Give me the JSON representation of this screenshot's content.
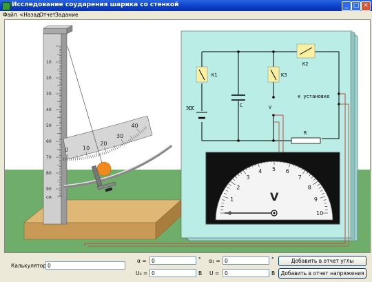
{
  "window": {
    "title": "Исследование соударения шарика со стенкой",
    "min": "_",
    "max": "□",
    "close": "×"
  },
  "menu": [
    {
      "label": "Файл"
    },
    {
      "label": "<Назад"
    },
    {
      "label": "Отчет"
    },
    {
      "label": "Задание"
    }
  ],
  "ruler": {
    "ticks": [
      "10",
      "20",
      "30",
      "40",
      "50",
      "60",
      "70",
      "80",
      "90"
    ],
    "unit": "см"
  },
  "protractor": {
    "ticks": [
      "0",
      "10",
      "20",
      "30",
      "40"
    ]
  },
  "circuit": {
    "k1": "K1",
    "k2": "K2",
    "k3": "K3",
    "emf": "ЭДС",
    "cap": "C",
    "volt": "V",
    "resistor": "R",
    "to_setup": "к установке"
  },
  "voltmeter": {
    "unit": "V",
    "scale": [
      "0",
      "1",
      "2",
      "3",
      "4",
      "5",
      "6",
      "7",
      "8",
      "9",
      "10"
    ],
    "reading": 0
  },
  "bottom": {
    "calc_label": "Калькулятор:",
    "calc_value": "0",
    "alpha_label": "α =",
    "alpha_value": "0",
    "alpha_unit": "°",
    "alpha1_label": "α₁ =",
    "alpha1_value": "0",
    "alpha1_unit": "°",
    "u0_label": "U₀ =",
    "u0_value": "0",
    "u0_unit": "В",
    "u_label": "U =",
    "u_value": "0",
    "u_unit": "В",
    "btn_angles": "Добавить в отчет углы",
    "btn_voltages": "Добавить в отчет напряжения"
  },
  "colors": {
    "sky": "#ffffff",
    "grass": "#6fae6a",
    "board": "#b9ede6",
    "wood": "#e0b876",
    "ball": "#f08a1e",
    "scale": "#cfcfcf"
  }
}
